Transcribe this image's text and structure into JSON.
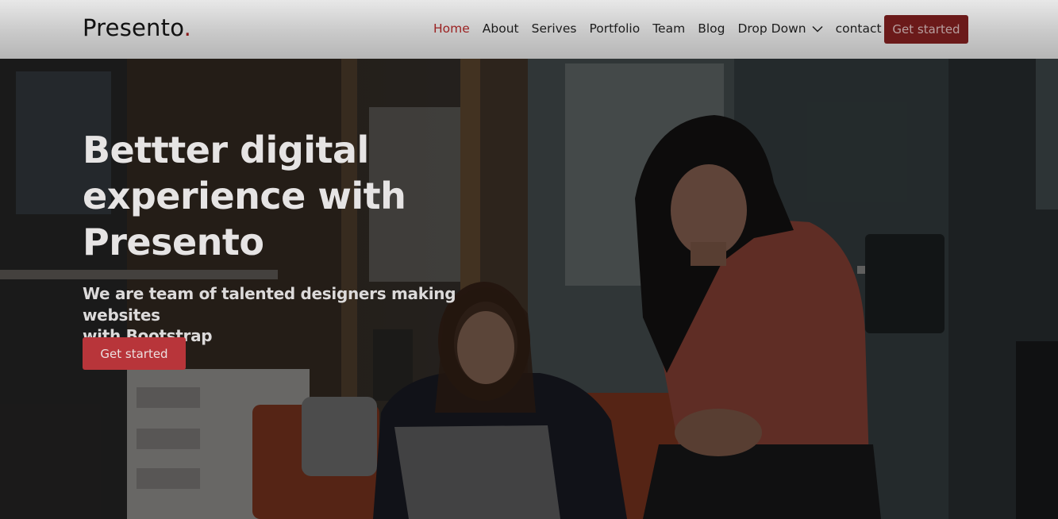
{
  "header": {
    "logo_text": "Presento",
    "logo_dot": ".",
    "nav": [
      {
        "label": "Home",
        "active": true
      },
      {
        "label": "About"
      },
      {
        "label": "Serives"
      },
      {
        "label": "Portfolio"
      },
      {
        "label": "Team"
      },
      {
        "label": "Blog"
      },
      {
        "label": "Drop Down",
        "dropdown": true
      },
      {
        "label": "contact"
      }
    ],
    "cta_label": "Get started"
  },
  "hero": {
    "title_line1": "Bettter digital",
    "title_line2": "experience with",
    "title_line3": "Presento",
    "subtitle_line1": "We are team of talented designers making websites",
    "subtitle_line2": "with Bootstrap",
    "cta_label": "Get started",
    "image_icon": "office-photo"
  },
  "colors": {
    "accent": "#b8353a",
    "accent_dark": "#6b1a1a",
    "nav_active": "#9b2222"
  }
}
